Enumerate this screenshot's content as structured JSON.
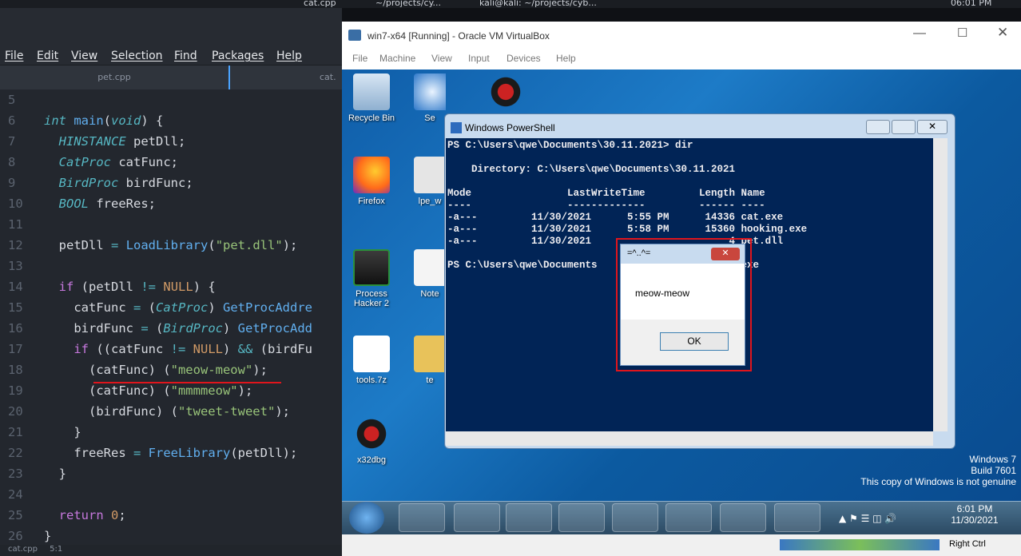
{
  "topbar": {
    "tab_label": "cat.cpp",
    "path1": "~/projects/cy...",
    "path2": "kali@kali: ~/projects/cyb...",
    "clock": "06:01 PM"
  },
  "editor": {
    "menu": [
      "File",
      "Edit",
      "View",
      "Selection",
      "Find",
      "Packages",
      "Help"
    ],
    "tabs": [
      "pet.cpp",
      "cat."
    ],
    "lines": [
      {
        "n": "5",
        "html": ""
      },
      {
        "n": "6",
        "html": "<span class='t'>int</span> <span class='f'>main</span>(<span class='t'>void</span>) {"
      },
      {
        "n": "7",
        "html": "  <span class='t'>HINSTANCE</span> petDll;"
      },
      {
        "n": "8",
        "html": "  <span class='t'>CatProc</span> catFunc;"
      },
      {
        "n": "9",
        "html": "  <span class='t'>BirdProc</span> birdFunc;"
      },
      {
        "n": "10",
        "html": "  <span class='t'>BOOL</span> freeRes;"
      },
      {
        "n": "11",
        "html": ""
      },
      {
        "n": "12",
        "html": "  petDll <span class='o'>=</span> <span class='f'>LoadLibrary</span>(<span class='s'>\"pet.dll\"</span>);"
      },
      {
        "n": "13",
        "html": ""
      },
      {
        "n": "14",
        "html": "  <span class='kw'>if</span> (petDll <span class='o'>!=</span> <span class='n'>NULL</span>) {"
      },
      {
        "n": "15",
        "html": "    catFunc <span class='o'>=</span> (<span class='t'>CatProc</span>) <span class='f'>GetProcAddre</span>"
      },
      {
        "n": "16",
        "html": "    birdFunc <span class='o'>=</span> (<span class='t'>BirdProc</span>) <span class='f'>GetProcAdd</span>"
      },
      {
        "n": "17",
        "html": "    <span class='kw'>if</span> ((catFunc <span class='o'>!=</span> <span class='n'>NULL</span>) <span class='o'>&amp;&amp;</span> (birdFu"
      },
      {
        "n": "18",
        "html": "      (catFunc) (<span class='s'>\"meow-meow\"</span>);"
      },
      {
        "n": "19",
        "html": "      (catFunc) (<span class='s'>\"mmmmeow\"</span>);"
      },
      {
        "n": "20",
        "html": "      (birdFunc) (<span class='s'>\"tweet-tweet\"</span>);"
      },
      {
        "n": "21",
        "html": "    }"
      },
      {
        "n": "22",
        "html": "    freeRes <span class='o'>=</span> <span class='f'>FreeLibrary</span>(petDll);"
      },
      {
        "n": "23",
        "html": "  }"
      },
      {
        "n": "24",
        "html": ""
      },
      {
        "n": "25",
        "html": "  <span class='kw'>return</span> <span class='n'>0</span>;"
      },
      {
        "n": "26",
        "html": "}"
      }
    ],
    "status_file": "cat.cpp",
    "status_pos": "5:1"
  },
  "vbox": {
    "title": "win7-x64 [Running] - Oracle VM VirtualBox",
    "menu": [
      "File",
      "Machine",
      "View",
      "Input",
      "Devices",
      "Help"
    ],
    "status_right": "Right Ctrl"
  },
  "desktop": {
    "icons": [
      "Recycle Bin",
      "Se",
      "Firefox",
      "lpe_w",
      "Process Hacker 2",
      "Note",
      "tools.7z",
      "te",
      "x32dbg"
    ],
    "watermark": [
      "Windows 7",
      "Build 7601",
      "This copy of Windows is not genuine"
    ]
  },
  "powershell": {
    "title": "Windows PowerShell",
    "lines": [
      "PS C:\\Users\\qwe\\Documents\\30.11.2021> dir",
      "",
      "    Directory: C:\\Users\\qwe\\Documents\\30.11.2021",
      "",
      "Mode                LastWriteTime         Length Name",
      "----                -------------         ------ ----",
      "-a---         11/30/2021      5:55 PM      14336 cat.exe",
      "-a---         11/30/2021      5:58 PM      15360 hooking.exe",
      "-a---         11/30/2021                       4 pet.dll",
      "",
      "PS C:\\Users\\qwe\\Documents                       .exe"
    ]
  },
  "msgbox": {
    "title": "=^..^=",
    "text": "meow-meow",
    "ok": "OK"
  },
  "taskbar": {
    "time": "6:01 PM",
    "date": "11/30/2021"
  }
}
